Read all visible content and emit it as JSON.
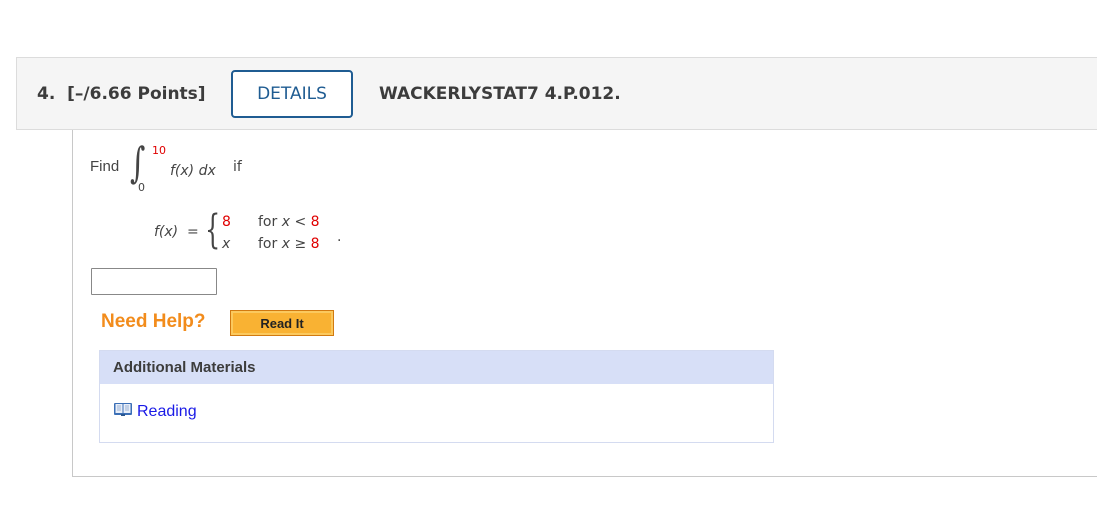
{
  "question": {
    "number": "4.",
    "points": "[–/6.66 Points]",
    "details_label": "DETAILS",
    "code": "WACKERLYSTAT7 4.P.012."
  },
  "problem": {
    "find_label": "Find",
    "integral_sign": "∫",
    "upper_limit": "10",
    "lower_limit": "0",
    "integrand_f": "f(x)",
    "integrand_dx": "dx",
    "if_word": "if",
    "fx_lhs": "f(x)  =",
    "brace": "{",
    "cases": [
      {
        "value": "8",
        "cond_prefix": "for ",
        "cond_var": "x",
        "cond_op": " < ",
        "cond_bound": "8"
      },
      {
        "value": "x",
        "cond_prefix": "for ",
        "cond_var": "x",
        "cond_op": " ≥ ",
        "cond_bound": "8"
      }
    ],
    "period": "."
  },
  "answer": {
    "value": "",
    "placeholder": ""
  },
  "help": {
    "need_help_label": "Need Help?",
    "read_it_label": "Read It"
  },
  "materials": {
    "title": "Additional Materials",
    "items": [
      {
        "icon": "book-icon",
        "label": "Reading"
      }
    ]
  },
  "colors": {
    "accent_blue": "#1f5c92",
    "red_values": "#e00000",
    "help_orange": "#f28c1c",
    "button_orange": "#f9b233",
    "materials_header": "#d7dff7",
    "link_blue": "#1a1ae6"
  }
}
